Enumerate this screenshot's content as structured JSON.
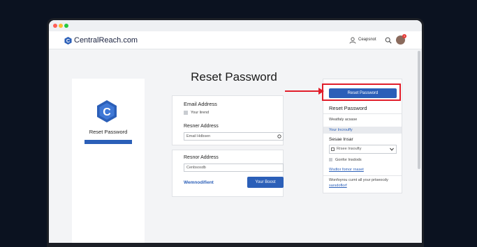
{
  "header": {
    "brand": "CentralReach.com",
    "user_label": "Ceapsnot"
  },
  "page": {
    "title": "Reset Password"
  },
  "left_card": {
    "title": "Reset Password"
  },
  "email_card": {
    "title": "Email Address",
    "checkbox_label": "Your lirend",
    "field_label": "Resner Address",
    "field_placeholder": "Email Hdbsen"
  },
  "recover_card": {
    "field_label": "Resnor Address",
    "field_placeholder": "Cenbsosdb",
    "link": "Wemnodifient",
    "button": "Your Boost"
  },
  "right_panel": {
    "button": "Reset Password",
    "title": "Reset Password",
    "line1": "Weatfaly acsase",
    "line2": "Your Incrouffy",
    "select_label": "Sesae Insar",
    "select_value": "Rrsee Insoufty",
    "checkbox_label": "Gonfor Insdods",
    "link": "Wsdtor fomor rnaset",
    "footer_text": "Wonfoyrou curnt all your prtseocdy",
    "footer_link": "sarsdoflorf"
  }
}
